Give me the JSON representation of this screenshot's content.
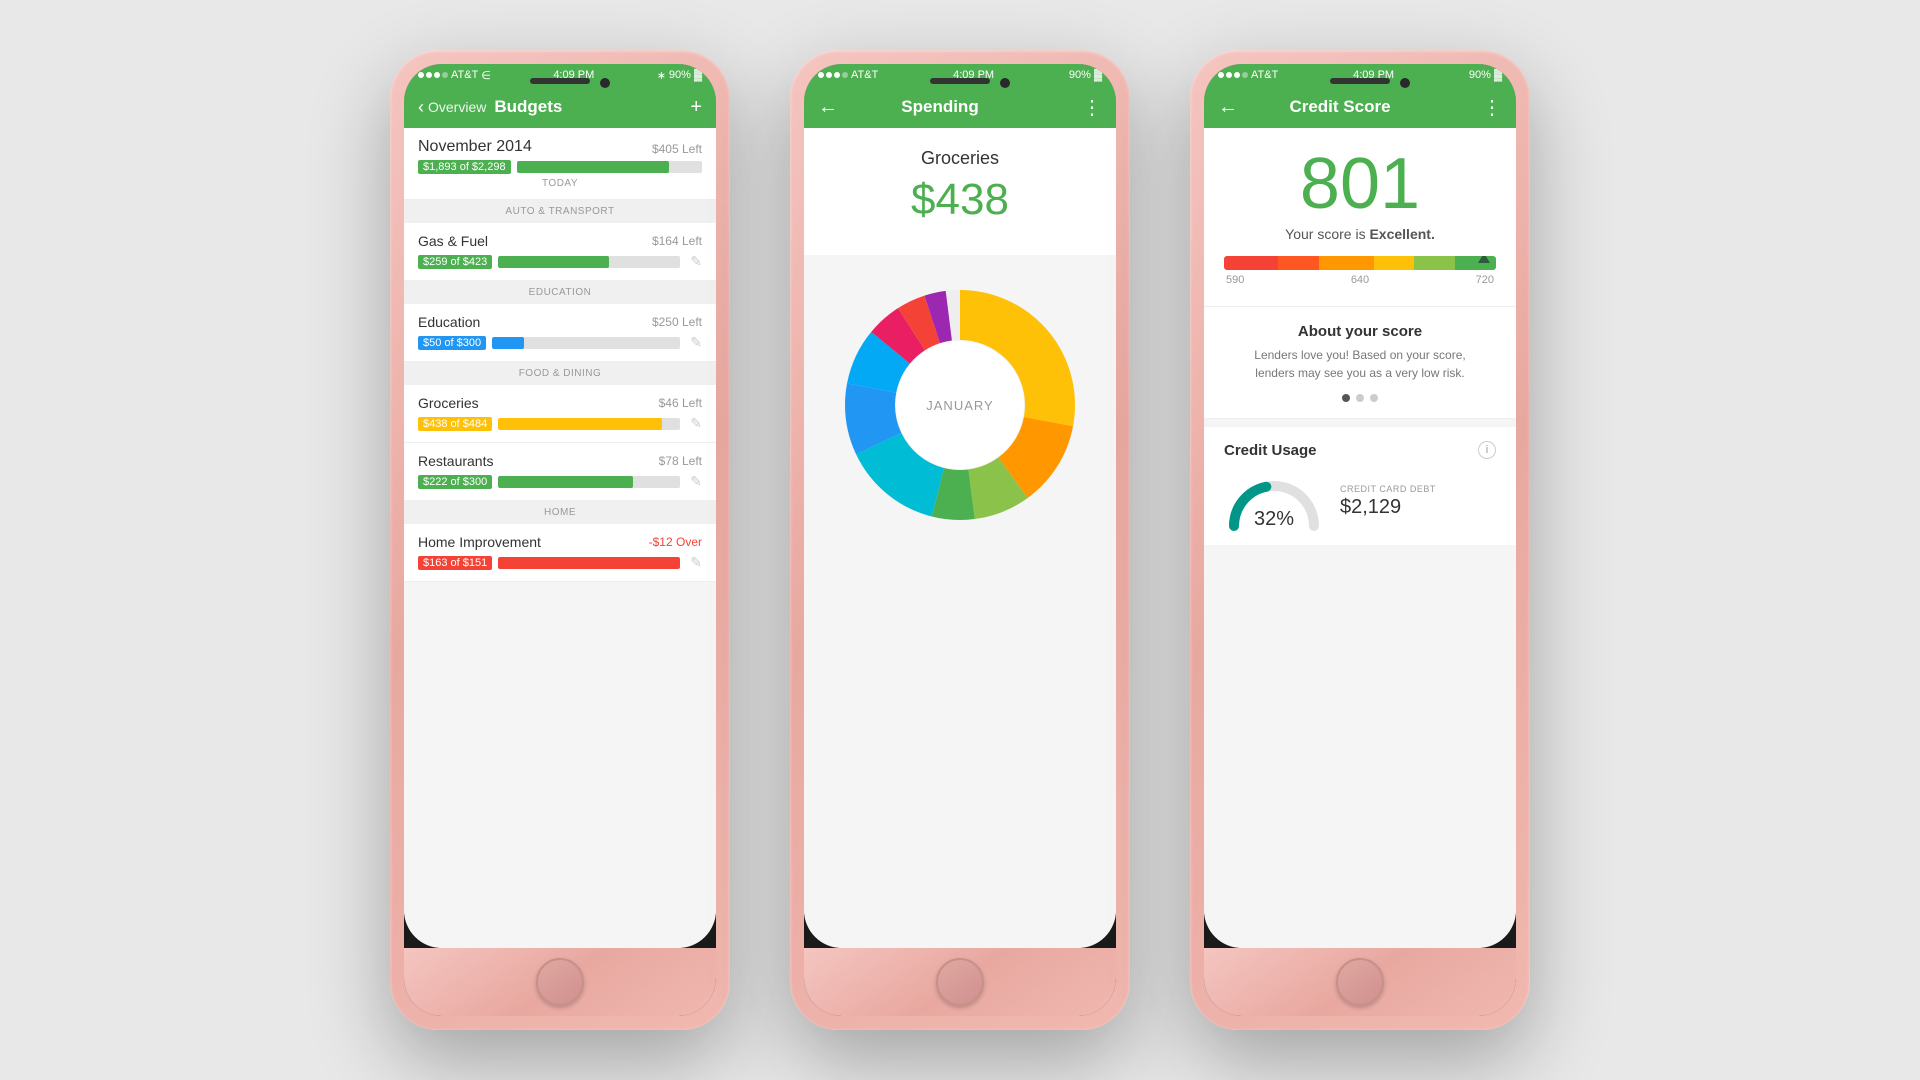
{
  "phones": [
    {
      "id": "budgets",
      "statusBar": {
        "carrier": "AT&T",
        "time": "4:09 PM",
        "battery": "90%"
      },
      "navBar": {
        "backLabel": "Overview",
        "title": "Budgets",
        "actionIcon": "+"
      },
      "sections": [
        {
          "type": "top_item",
          "date": "November 2014",
          "rightLabel": "$405 Left",
          "progressLabel": "$1,893 of $2,298",
          "progressPercent": 82,
          "progressColor": "#4CAF50",
          "sectionLabel": "TODAY"
        },
        {
          "type": "section_header",
          "label": "AUTO & TRANSPORT"
        },
        {
          "type": "budget_item",
          "name": "Gas & Fuel",
          "leftLabel": "$164 Left",
          "progressLabel": "$259 of $423",
          "progressPercent": 61,
          "progressColor": "#4CAF50",
          "leftOver": false
        },
        {
          "type": "section_header",
          "label": "EDUCATION"
        },
        {
          "type": "budget_item",
          "name": "Education",
          "leftLabel": "$250 Left",
          "progressLabel": "$50 of $300",
          "progressPercent": 17,
          "progressColor": "#2196F3",
          "leftOver": false
        },
        {
          "type": "section_header",
          "label": "FOOD & DINING"
        },
        {
          "type": "budget_item",
          "name": "Groceries",
          "leftLabel": "$46 Left",
          "progressLabel": "$438 of $484",
          "progressPercent": 90,
          "progressColor": "#FFC107",
          "leftOver": false
        },
        {
          "type": "budget_item",
          "name": "Restaurants",
          "leftLabel": "$78 Left",
          "progressLabel": "$222 of $300",
          "progressPercent": 74,
          "progressColor": "#4CAF50",
          "leftOver": false
        },
        {
          "type": "section_header",
          "label": "HOME"
        },
        {
          "type": "budget_item",
          "name": "Home Improvement",
          "leftLabel": "-$12 Over",
          "progressLabel": "$163 of $151",
          "progressPercent": 100,
          "progressColor": "#F44336",
          "leftOver": true
        }
      ]
    },
    {
      "id": "spending",
      "statusBar": {
        "carrier": "AT&T",
        "time": "4:09 PM",
        "battery": "90%"
      },
      "navBar": {
        "backLabel": "",
        "title": "Spending",
        "actionIcon": "⋮"
      },
      "spendingCategory": "Groceries",
      "spendingAmount": "$438",
      "chartLabel": "JANUARY",
      "chartSegments": [
        {
          "color": "#FFC107",
          "percent": 28
        },
        {
          "color": "#FF9800",
          "percent": 12
        },
        {
          "color": "#8BC34A",
          "percent": 8
        },
        {
          "color": "#4CAF50",
          "percent": 6
        },
        {
          "color": "#00BCD4",
          "percent": 14
        },
        {
          "color": "#2196F3",
          "percent": 10
        },
        {
          "color": "#03A9F4",
          "percent": 8
        },
        {
          "color": "#E91E63",
          "percent": 5
        },
        {
          "color": "#F44336",
          "percent": 4
        },
        {
          "color": "#9C27B0",
          "percent": 3
        },
        {
          "color": "#FF5722",
          "percent": 2
        }
      ]
    },
    {
      "id": "credit_score",
      "statusBar": {
        "carrier": "AT&T",
        "time": "4:09 PM",
        "battery": "90%"
      },
      "navBar": {
        "backLabel": "",
        "title": "Credit Score",
        "actionIcon": "⋮"
      },
      "scoreNumber": "801",
      "scoreLabel": "Your score is ",
      "scoreQuality": "Excellent.",
      "scoreBar": {
        "segments": [
          {
            "color": "#F44336",
            "width": 20
          },
          {
            "color": "#FF5722",
            "width": 15
          },
          {
            "color": "#FF9800",
            "width": 20
          },
          {
            "color": "#FFC107",
            "width": 15
          },
          {
            "color": "#8BC34A",
            "width": 15
          },
          {
            "color": "#4CAF50",
            "width": 15
          }
        ],
        "labels": [
          "590",
          "640",
          "720"
        ],
        "pointerPercent": 93
      },
      "aboutScore": {
        "title": "About your score",
        "text": "Lenders love you! Based on your score,\nlenders may see you as a very low risk."
      },
      "creditUsage": {
        "title": "Credit Usage",
        "percent": "32%",
        "gaugeFill": 32,
        "debtLabel": "CREDIT CARD DEBT",
        "debtValue": "$2,129"
      }
    }
  ]
}
